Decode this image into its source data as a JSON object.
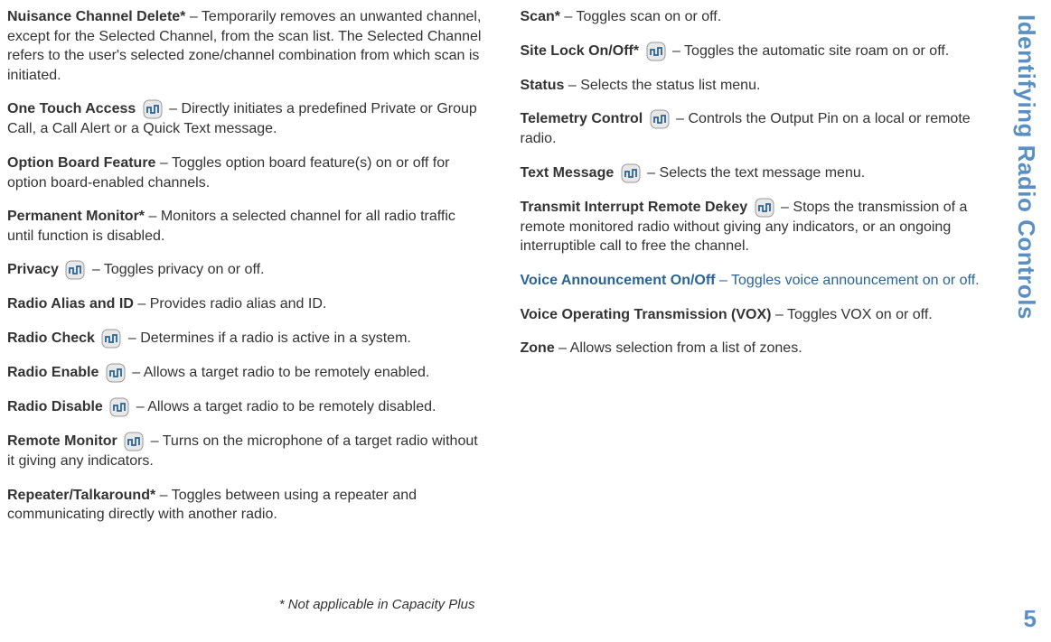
{
  "sidebar_title": "Identifying Radio Controls",
  "page_number": "5",
  "footnote": "* Not applicable in Capacity Plus",
  "left": [
    {
      "term": "Nuisance Channel Delete*",
      "desc": "Temporarily removes an unwanted channel, except for the Selected Channel, from the scan list. The Selected Channel refers to the user's selected zone/channel combination from which scan is initiated.",
      "icon": false
    },
    {
      "term": "One Touch Access",
      "desc": "Directly initiates a predefined Private or Group Call, a Call Alert or a Quick Text message.",
      "icon": true
    },
    {
      "term": "Option Board Feature",
      "desc": "Toggles option board feature(s) on or off for option board-enabled channels.",
      "icon": false
    },
    {
      "term": "Permanent Monitor*",
      "desc": "Monitors a selected channel for all radio traffic until function is disabled.",
      "icon": false
    },
    {
      "term": "Privacy",
      "desc": "Toggles privacy on or off.",
      "icon": true
    },
    {
      "term": "Radio Alias and ID",
      "desc": "Provides radio alias and ID.",
      "icon": false
    },
    {
      "term": "Radio Check",
      "desc": "Determines if a radio is active in a system.",
      "icon": true
    },
    {
      "term": "Radio Enable",
      "desc": "Allows a target radio to be remotely enabled.",
      "icon": true
    },
    {
      "term": "Radio Disable",
      "desc": "Allows a target radio to be remotely disabled.",
      "icon": true
    },
    {
      "term": "Remote Monitor",
      "desc": "Turns on the microphone of a target radio without it giving any indicators.",
      "icon": true
    },
    {
      "term": "Repeater/Talkaround*",
      "desc": "Toggles between using a repeater and communicating directly with another radio.",
      "icon": false
    }
  ],
  "right": [
    {
      "term": "Scan*",
      "desc": "Toggles scan on or off.",
      "icon": false,
      "accent": false
    },
    {
      "term": "Site Lock On/Off*",
      "desc": "Toggles the automatic site roam on or off.",
      "icon": true,
      "accent": false
    },
    {
      "term": "Status",
      "desc": "Selects the status list menu.",
      "icon": false,
      "accent": false
    },
    {
      "term": "Telemetry Control",
      "desc": "Controls the Output Pin on a local or remote radio.",
      "icon": true,
      "accent": false
    },
    {
      "term": "Text Message",
      "desc": "Selects the text message menu.",
      "icon": true,
      "accent": false
    },
    {
      "term": "Transmit Interrupt Remote Dekey",
      "desc": "Stops the transmission of a remote monitored radio without giving any indicators, or an ongoing interruptible call to free the channel.",
      "icon": true,
      "accent": false
    },
    {
      "term": "Voice Announcement On/Off",
      "desc": "Toggles voice announcement on or off.",
      "icon": false,
      "accent": true
    },
    {
      "term": "Voice Operating Transmission (VOX)",
      "desc": "Toggles VOX on or off.",
      "icon": false,
      "accent": false
    },
    {
      "term": "Zone",
      "desc": "Allows selection from a list of zones.",
      "icon": false,
      "accent": false
    }
  ]
}
